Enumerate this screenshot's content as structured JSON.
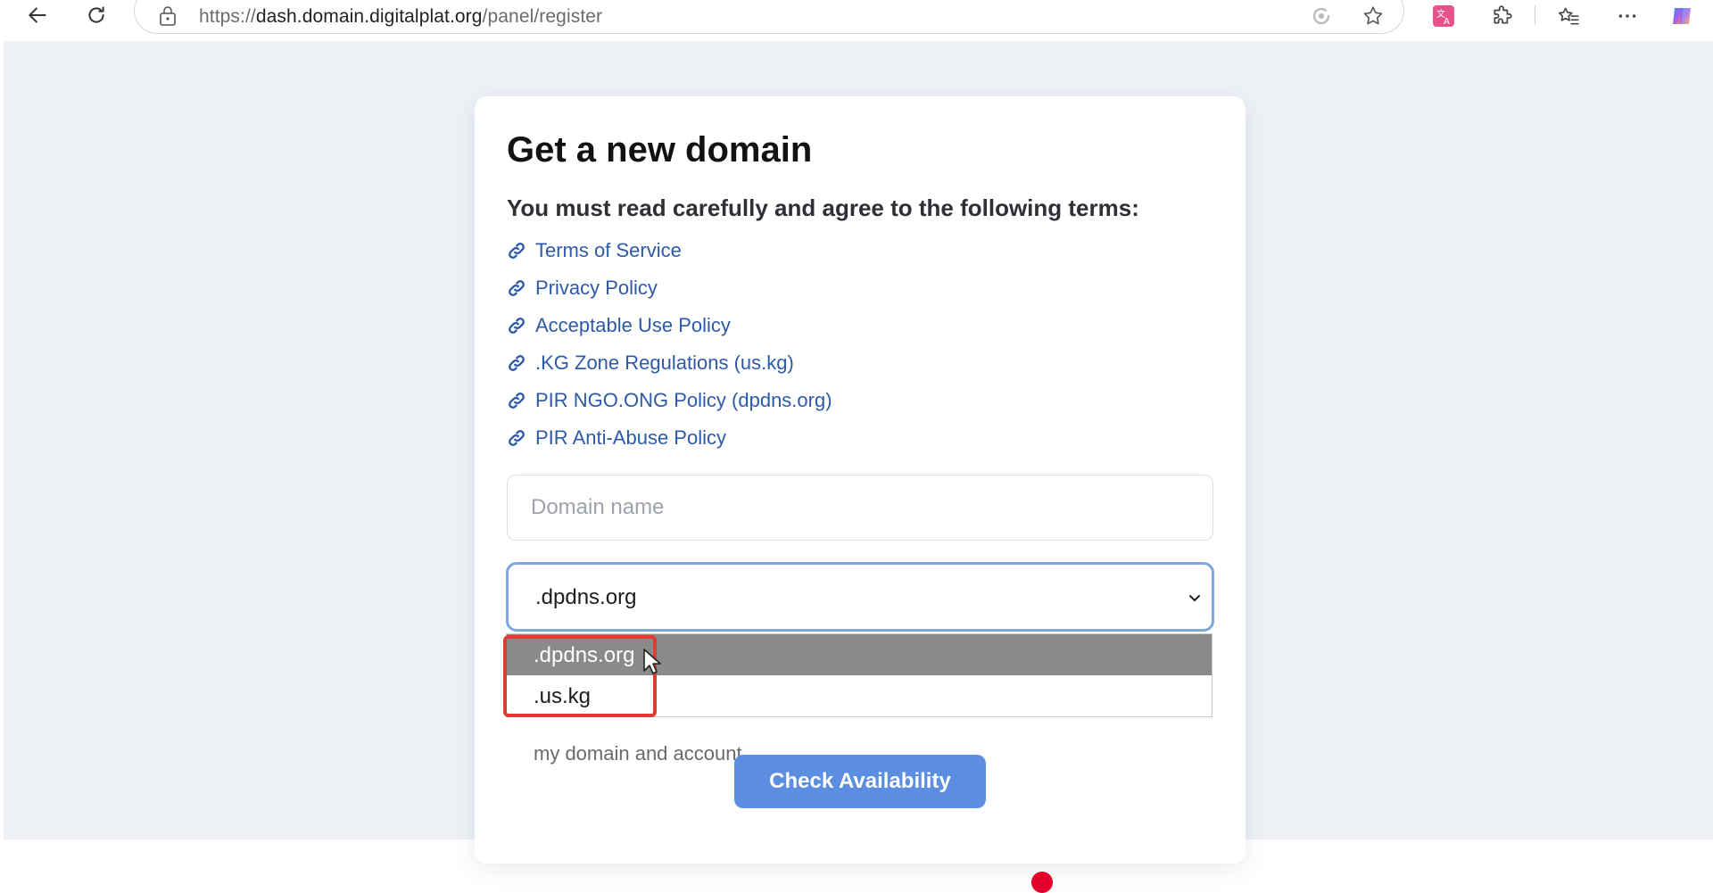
{
  "browser": {
    "url_prefix": "https://",
    "url_domain": "dash.domain.digitalplat.org",
    "url_path": "/panel/register"
  },
  "form": {
    "title": "Get a new domain",
    "terms_heading": "You must read carefully and agree to the following terms:",
    "links": [
      {
        "label": "Terms of Service"
      },
      {
        "label": "Privacy Policy"
      },
      {
        "label": "Acceptable Use Policy"
      },
      {
        "label": ".KG Zone Regulations (us.kg)"
      },
      {
        "label": "PIR NGO.ONG Policy (dpdns.org)"
      },
      {
        "label": "PIR Anti-Abuse Policy"
      }
    ],
    "domain_placeholder": "Domain name",
    "domain_value": "",
    "suffix_selected": ".dpdns.org",
    "suffix_options": [
      ".dpdns.org",
      ".us.kg"
    ],
    "partial_text": "my domain and account.",
    "check_button": "Check Availability"
  },
  "colors": {
    "link": "#2d5aa8",
    "button": "#5b8de0",
    "highlight": "#e03a35",
    "selected_option_bg": "#8a8a8a"
  }
}
